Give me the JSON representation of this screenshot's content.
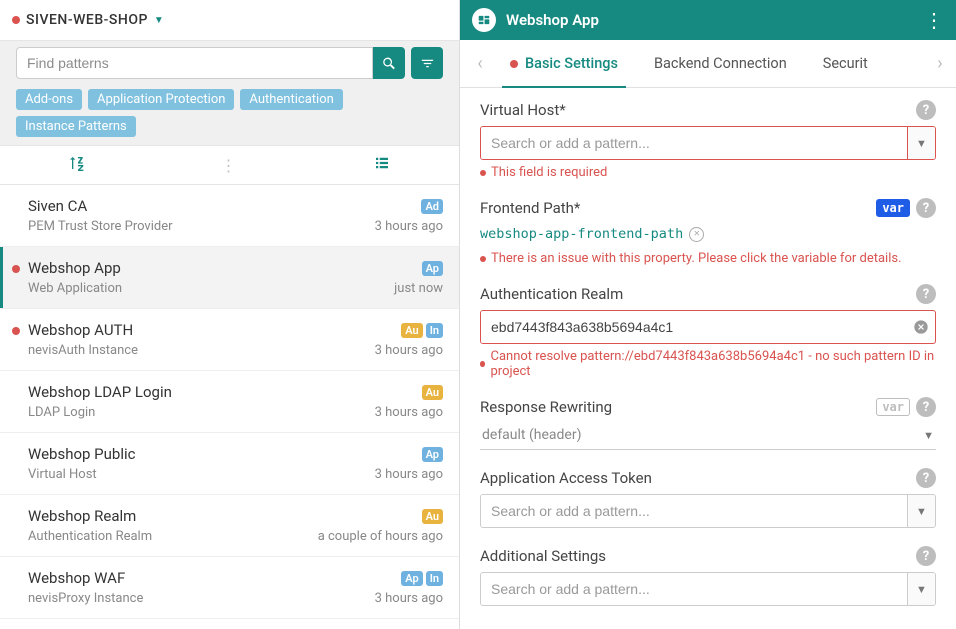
{
  "left": {
    "title": "SIVEN-WEB-SHOP",
    "search_placeholder": "Find patterns",
    "chips": [
      "Add-ons",
      "Application Protection",
      "Authentication",
      "Instance Patterns"
    ]
  },
  "patterns": [
    {
      "name": "Siven CA",
      "sub": "PEM Trust Store Provider",
      "time": "3 hours ago",
      "badges": [
        "Ad"
      ],
      "marker": false,
      "selected": false
    },
    {
      "name": "Webshop App",
      "sub": "Web Application",
      "time": "just now",
      "badges": [
        "Ap"
      ],
      "marker": true,
      "selected": true
    },
    {
      "name": "Webshop AUTH",
      "sub": "nevisAuth Instance",
      "time": "3 hours ago",
      "badges": [
        "Au",
        "In"
      ],
      "marker": true,
      "selected": false
    },
    {
      "name": "Webshop LDAP Login",
      "sub": "LDAP Login",
      "time": "3 hours ago",
      "badges": [
        "Au"
      ],
      "marker": false,
      "selected": false
    },
    {
      "name": "Webshop Public",
      "sub": "Virtual Host",
      "time": "3 hours ago",
      "badges": [
        "Ap"
      ],
      "marker": false,
      "selected": false
    },
    {
      "name": "Webshop Realm",
      "sub": "Authentication Realm",
      "time": "a couple of hours ago",
      "badges": [
        "Au"
      ],
      "marker": false,
      "selected": false
    },
    {
      "name": "Webshop WAF",
      "sub": "nevisProxy Instance",
      "time": "3 hours ago",
      "badges": [
        "Ap",
        "In"
      ],
      "marker": false,
      "selected": false
    }
  ],
  "right": {
    "title": "Webshop App",
    "tabs": {
      "basic": "Basic Settings",
      "backend": "Backend Connection",
      "security": "Securit"
    }
  },
  "fields": {
    "virtual_host": {
      "label": "Virtual Host*",
      "placeholder": "Search or add a pattern...",
      "error": "This field is required"
    },
    "frontend_path": {
      "label": "Frontend Path*",
      "var_link": "webshop-app-frontend-path",
      "error": "There is an issue with this property. Please click the variable for details."
    },
    "auth_realm": {
      "label": "Authentication Realm",
      "value": "ebd7443f843a638b5694a4c1",
      "error": "Cannot resolve pattern://ebd7443f843a638b5694a4c1 - no such pattern ID in project"
    },
    "response_rewriting": {
      "label": "Response Rewriting",
      "value": "default (header)"
    },
    "access_token": {
      "label": "Application Access Token",
      "placeholder": "Search or add a pattern..."
    },
    "additional": {
      "label": "Additional Settings",
      "placeholder": "Search or add a pattern..."
    },
    "var_text": "var"
  }
}
